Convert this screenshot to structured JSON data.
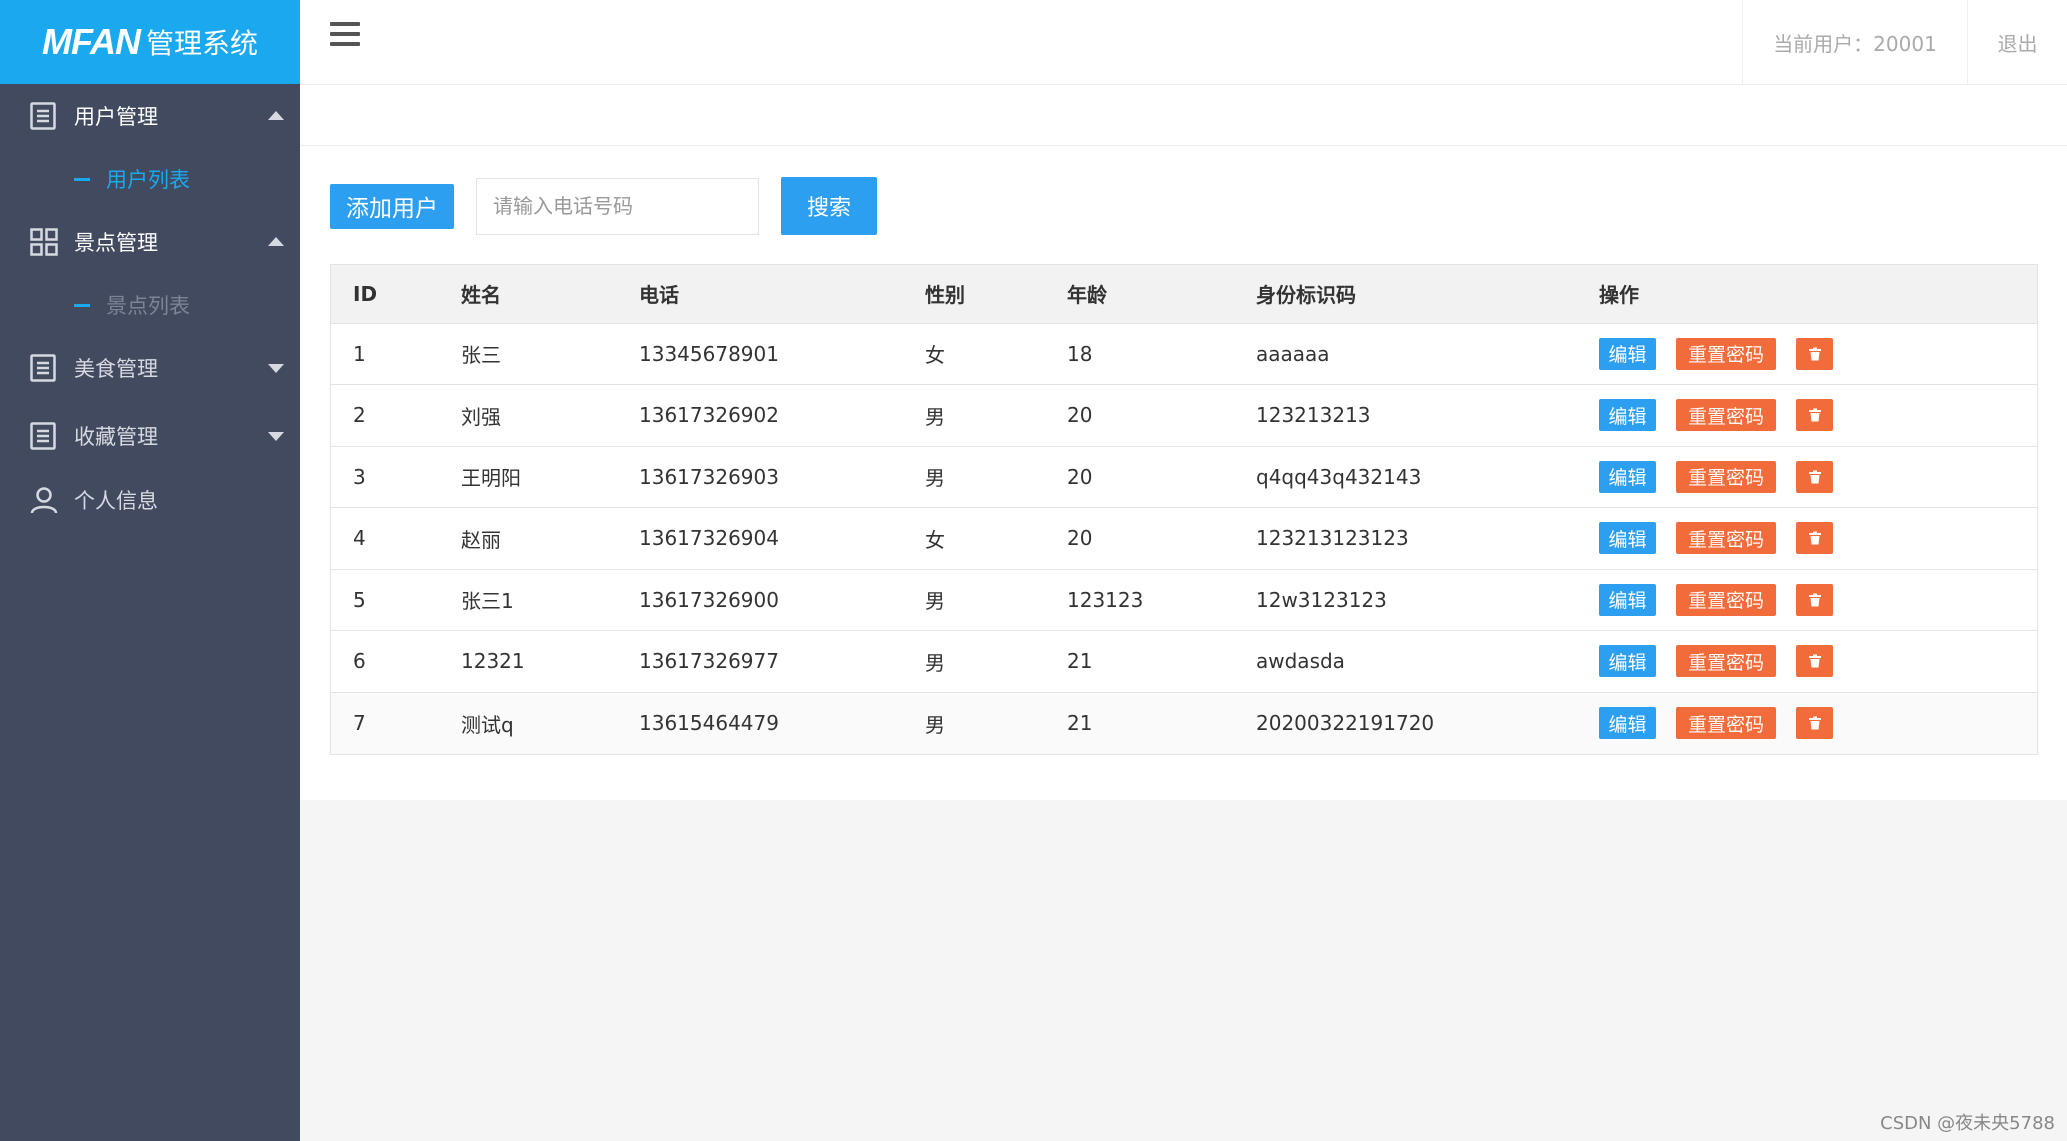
{
  "app": {
    "brand": "MFAN",
    "system_name": "管理系统"
  },
  "sidebar": {
    "groups": [
      {
        "label": "用户管理",
        "icon": "list-icon",
        "expanded": true,
        "children": [
          "用户列表"
        ]
      },
      {
        "label": "景点管理",
        "icon": "grid-icon",
        "expanded": true,
        "children": [
          "景点列表"
        ]
      },
      {
        "label": "美食管理",
        "icon": "list-icon",
        "expanded": false
      },
      {
        "label": "收藏管理",
        "icon": "list-icon",
        "expanded": false
      },
      {
        "label": "个人信息",
        "icon": "user-icon"
      }
    ]
  },
  "header": {
    "current_user": "当前用户：20001",
    "logout": "退出"
  },
  "toolbar": {
    "add_label": "添加用户",
    "search_placeholder": "请输入电话号码",
    "search_label": "搜索"
  },
  "table": {
    "columns": [
      "ID",
      "姓名",
      "电话",
      "性别",
      "年龄",
      "身份标识码",
      "操作"
    ],
    "rows": [
      [
        "1",
        "张三",
        "13345678901",
        "女",
        "18",
        "aaaaaa"
      ],
      [
        "2",
        "刘强",
        "13617326902",
        "男",
        "20",
        "123213213"
      ],
      [
        "3",
        "王明阳",
        "13617326903",
        "男",
        "20",
        "q4qq43q432143"
      ],
      [
        "4",
        "赵丽",
        "13617326904",
        "女",
        "20",
        "123213123123"
      ],
      [
        "5",
        "张三1",
        "13617326900",
        "男",
        "123123",
        "12w3123123"
      ],
      [
        "6",
        "12321",
        "13617326977",
        "男",
        "21",
        "awdasda"
      ],
      [
        "7",
        "测试q",
        "13615464479",
        "男",
        "21",
        "20200322191720"
      ]
    ],
    "actions": {
      "edit": "编辑",
      "reset_password": "重置密码",
      "delete_icon": "trash-icon"
    }
  },
  "watermark": "CSDN @夜未央5788",
  "colors": {
    "sidebar_bg": "#424a5f",
    "logo_bg": "#1aa9ef",
    "primary": "#2d9ff0",
    "danger": "#f26b3a"
  }
}
